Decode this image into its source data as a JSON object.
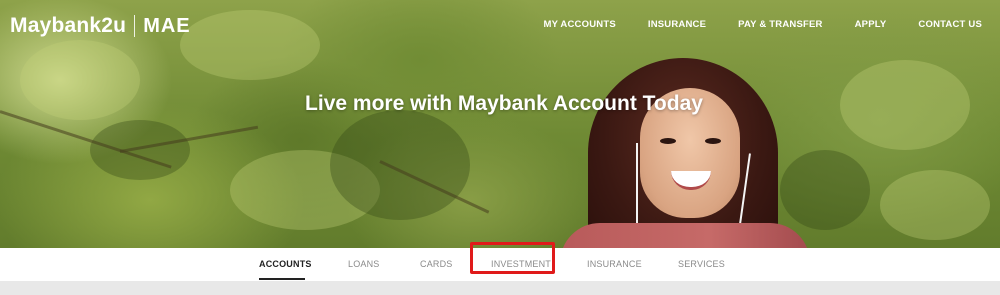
{
  "header": {
    "logo_brand": "Maybank2u",
    "logo_sub": "MAE",
    "nav": [
      "MY ACCOUNTS",
      "INSURANCE",
      "PAY & TRANSFER",
      "APPLY",
      "CONTACT US"
    ]
  },
  "hero": {
    "headline": "Live more with Maybank Account Today"
  },
  "tabs": [
    {
      "label": "ACCOUNTS",
      "active": true
    },
    {
      "label": "LOANS"
    },
    {
      "label": "CARDS"
    },
    {
      "label": "INVESTMENT",
      "highlighted": true
    },
    {
      "label": "INSURANCE"
    },
    {
      "label": "SERVICES"
    }
  ],
  "colors": {
    "highlight_border": "#e01a1a",
    "active_tab": "#222222",
    "inactive_tab": "#8a8a8a"
  }
}
